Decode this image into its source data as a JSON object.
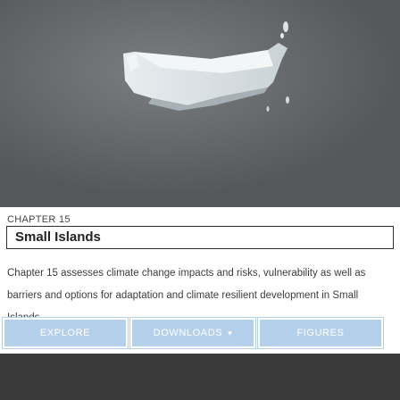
{
  "hero": {
    "image_icon": "melting-ice-image"
  },
  "chapter": {
    "label": "CHAPTER 15",
    "title": "Small Islands",
    "summary": "Chapter 15 assesses climate change impacts and risks, vulnerability as well as barriers and options for adaptation and climate resilient development in Small Islands."
  },
  "actions": {
    "explore_label": "EXPLORE",
    "downloads_label": "DOWNLOADS",
    "downloads_caret": "▾",
    "figures_label": "FIGURES"
  },
  "colors": {
    "button_bg": "#b4d0ea",
    "bottom_bar": "#3a3a3a"
  }
}
